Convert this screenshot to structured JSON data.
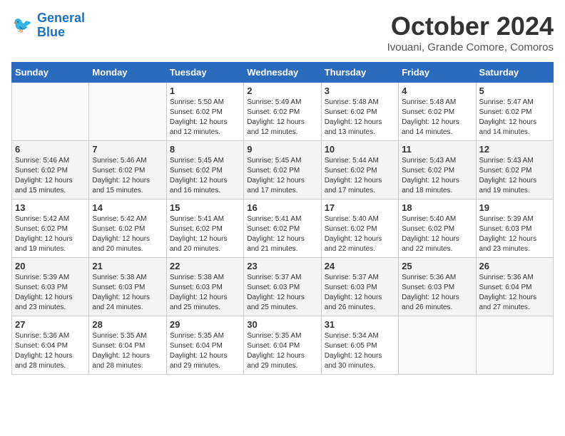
{
  "header": {
    "logo_line1": "General",
    "logo_line2": "Blue",
    "month": "October 2024",
    "location": "Ivouani, Grande Comore, Comoros"
  },
  "days_of_week": [
    "Sunday",
    "Monday",
    "Tuesday",
    "Wednesday",
    "Thursday",
    "Friday",
    "Saturday"
  ],
  "weeks": [
    [
      {
        "day": "",
        "sunrise": "",
        "sunset": "",
        "daylight": ""
      },
      {
        "day": "",
        "sunrise": "",
        "sunset": "",
        "daylight": ""
      },
      {
        "day": "1",
        "sunrise": "Sunrise: 5:50 AM",
        "sunset": "Sunset: 6:02 PM",
        "daylight": "Daylight: 12 hours and 12 minutes."
      },
      {
        "day": "2",
        "sunrise": "Sunrise: 5:49 AM",
        "sunset": "Sunset: 6:02 PM",
        "daylight": "Daylight: 12 hours and 12 minutes."
      },
      {
        "day": "3",
        "sunrise": "Sunrise: 5:48 AM",
        "sunset": "Sunset: 6:02 PM",
        "daylight": "Daylight: 12 hours and 13 minutes."
      },
      {
        "day": "4",
        "sunrise": "Sunrise: 5:48 AM",
        "sunset": "Sunset: 6:02 PM",
        "daylight": "Daylight: 12 hours and 14 minutes."
      },
      {
        "day": "5",
        "sunrise": "Sunrise: 5:47 AM",
        "sunset": "Sunset: 6:02 PM",
        "daylight": "Daylight: 12 hours and 14 minutes."
      }
    ],
    [
      {
        "day": "6",
        "sunrise": "Sunrise: 5:46 AM",
        "sunset": "Sunset: 6:02 PM",
        "daylight": "Daylight: 12 hours and 15 minutes."
      },
      {
        "day": "7",
        "sunrise": "Sunrise: 5:46 AM",
        "sunset": "Sunset: 6:02 PM",
        "daylight": "Daylight: 12 hours and 15 minutes."
      },
      {
        "day": "8",
        "sunrise": "Sunrise: 5:45 AM",
        "sunset": "Sunset: 6:02 PM",
        "daylight": "Daylight: 12 hours and 16 minutes."
      },
      {
        "day": "9",
        "sunrise": "Sunrise: 5:45 AM",
        "sunset": "Sunset: 6:02 PM",
        "daylight": "Daylight: 12 hours and 17 minutes."
      },
      {
        "day": "10",
        "sunrise": "Sunrise: 5:44 AM",
        "sunset": "Sunset: 6:02 PM",
        "daylight": "Daylight: 12 hours and 17 minutes."
      },
      {
        "day": "11",
        "sunrise": "Sunrise: 5:43 AM",
        "sunset": "Sunset: 6:02 PM",
        "daylight": "Daylight: 12 hours and 18 minutes."
      },
      {
        "day": "12",
        "sunrise": "Sunrise: 5:43 AM",
        "sunset": "Sunset: 6:02 PM",
        "daylight": "Daylight: 12 hours and 19 minutes."
      }
    ],
    [
      {
        "day": "13",
        "sunrise": "Sunrise: 5:42 AM",
        "sunset": "Sunset: 6:02 PM",
        "daylight": "Daylight: 12 hours and 19 minutes."
      },
      {
        "day": "14",
        "sunrise": "Sunrise: 5:42 AM",
        "sunset": "Sunset: 6:02 PM",
        "daylight": "Daylight: 12 hours and 20 minutes."
      },
      {
        "day": "15",
        "sunrise": "Sunrise: 5:41 AM",
        "sunset": "Sunset: 6:02 PM",
        "daylight": "Daylight: 12 hours and 20 minutes."
      },
      {
        "day": "16",
        "sunrise": "Sunrise: 5:41 AM",
        "sunset": "Sunset: 6:02 PM",
        "daylight": "Daylight: 12 hours and 21 minutes."
      },
      {
        "day": "17",
        "sunrise": "Sunrise: 5:40 AM",
        "sunset": "Sunset: 6:02 PM",
        "daylight": "Daylight: 12 hours and 22 minutes."
      },
      {
        "day": "18",
        "sunrise": "Sunrise: 5:40 AM",
        "sunset": "Sunset: 6:02 PM",
        "daylight": "Daylight: 12 hours and 22 minutes."
      },
      {
        "day": "19",
        "sunrise": "Sunrise: 5:39 AM",
        "sunset": "Sunset: 6:03 PM",
        "daylight": "Daylight: 12 hours and 23 minutes."
      }
    ],
    [
      {
        "day": "20",
        "sunrise": "Sunrise: 5:39 AM",
        "sunset": "Sunset: 6:03 PM",
        "daylight": "Daylight: 12 hours and 23 minutes."
      },
      {
        "day": "21",
        "sunrise": "Sunrise: 5:38 AM",
        "sunset": "Sunset: 6:03 PM",
        "daylight": "Daylight: 12 hours and 24 minutes."
      },
      {
        "day": "22",
        "sunrise": "Sunrise: 5:38 AM",
        "sunset": "Sunset: 6:03 PM",
        "daylight": "Daylight: 12 hours and 25 minutes."
      },
      {
        "day": "23",
        "sunrise": "Sunrise: 5:37 AM",
        "sunset": "Sunset: 6:03 PM",
        "daylight": "Daylight: 12 hours and 25 minutes."
      },
      {
        "day": "24",
        "sunrise": "Sunrise: 5:37 AM",
        "sunset": "Sunset: 6:03 PM",
        "daylight": "Daylight: 12 hours and 26 minutes."
      },
      {
        "day": "25",
        "sunrise": "Sunrise: 5:36 AM",
        "sunset": "Sunset: 6:03 PM",
        "daylight": "Daylight: 12 hours and 26 minutes."
      },
      {
        "day": "26",
        "sunrise": "Sunrise: 5:36 AM",
        "sunset": "Sunset: 6:04 PM",
        "daylight": "Daylight: 12 hours and 27 minutes."
      }
    ],
    [
      {
        "day": "27",
        "sunrise": "Sunrise: 5:36 AM",
        "sunset": "Sunset: 6:04 PM",
        "daylight": "Daylight: 12 hours and 28 minutes."
      },
      {
        "day": "28",
        "sunrise": "Sunrise: 5:35 AM",
        "sunset": "Sunset: 6:04 PM",
        "daylight": "Daylight: 12 hours and 28 minutes."
      },
      {
        "day": "29",
        "sunrise": "Sunrise: 5:35 AM",
        "sunset": "Sunset: 6:04 PM",
        "daylight": "Daylight: 12 hours and 29 minutes."
      },
      {
        "day": "30",
        "sunrise": "Sunrise: 5:35 AM",
        "sunset": "Sunset: 6:04 PM",
        "daylight": "Daylight: 12 hours and 29 minutes."
      },
      {
        "day": "31",
        "sunrise": "Sunrise: 5:34 AM",
        "sunset": "Sunset: 6:05 PM",
        "daylight": "Daylight: 12 hours and 30 minutes."
      },
      {
        "day": "",
        "sunrise": "",
        "sunset": "",
        "daylight": ""
      },
      {
        "day": "",
        "sunrise": "",
        "sunset": "",
        "daylight": ""
      }
    ]
  ]
}
